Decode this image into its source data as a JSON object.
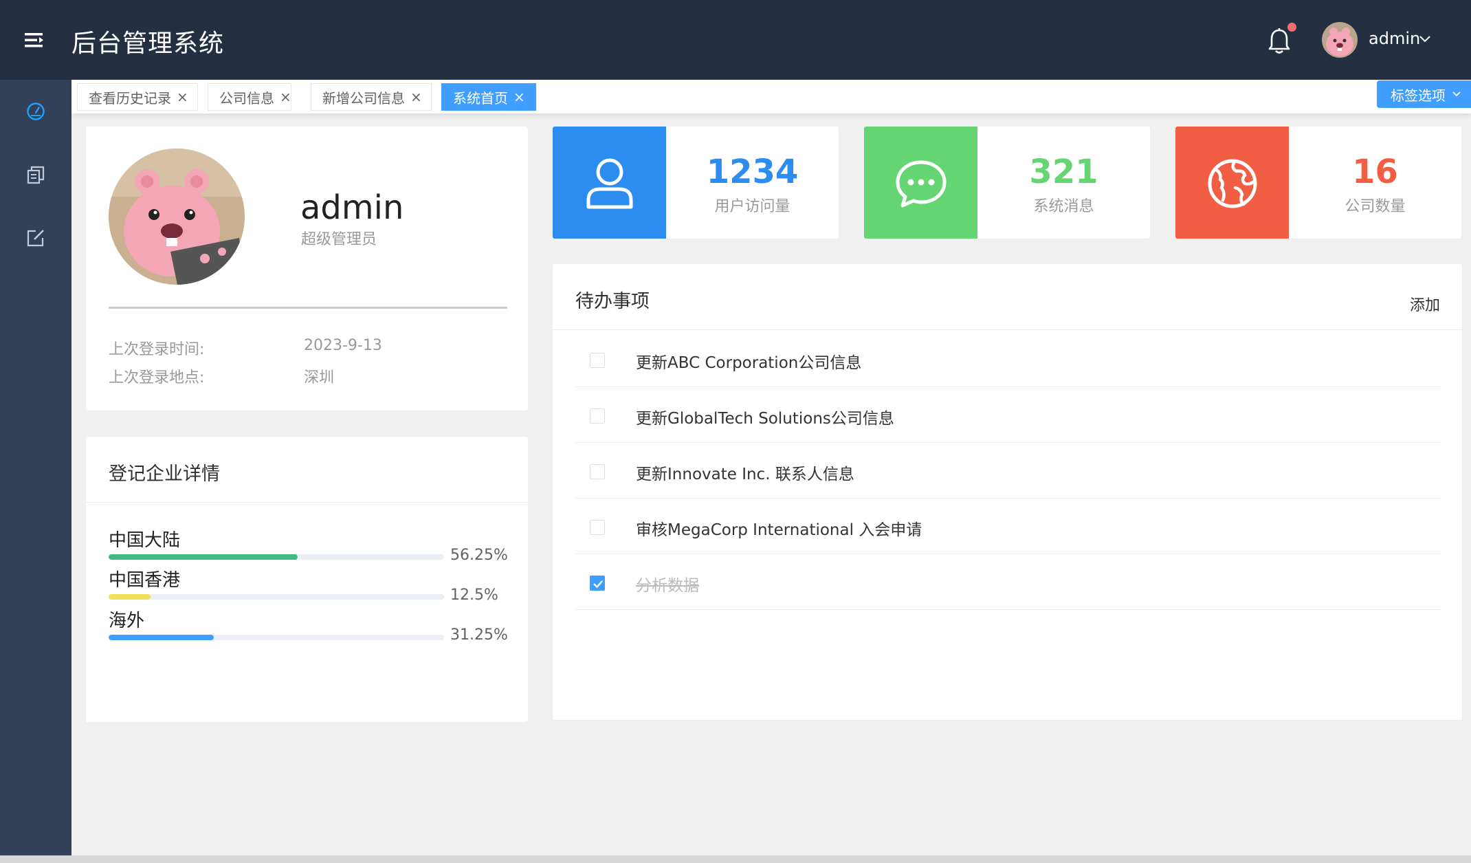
{
  "header": {
    "title": "后台管理系统",
    "username": "admin",
    "menu_icon": "menu-fold-icon",
    "bell_icon": "bell-icon",
    "has_unread": true
  },
  "sidebar": {
    "items": [
      {
        "icon": "dashboard-icon",
        "active": true
      },
      {
        "icon": "document-copy-icon",
        "active": false
      },
      {
        "icon": "edit-icon",
        "active": false
      }
    ]
  },
  "tags": {
    "items": [
      {
        "label": "查看历史记录",
        "active": false
      },
      {
        "label": "公司信息",
        "active": false
      },
      {
        "label": "新增公司信息",
        "active": false
      },
      {
        "label": "系统首页",
        "active": true
      }
    ],
    "options_label": "标签选项"
  },
  "profile": {
    "name": "admin",
    "role": "超级管理员",
    "last_login_time_label": "上次登录时间:",
    "last_login_time": "2023-9-13",
    "last_login_place_label": "上次登录地点:",
    "last_login_place": "深圳"
  },
  "regions": {
    "title": "登记企业详情",
    "items": [
      {
        "name": "中国大陆",
        "percent": 56.25,
        "label": "56.25%",
        "color": "#42b983"
      },
      {
        "name": "中国香港",
        "percent": 12.5,
        "label": "12.5%",
        "color": "#f1e05a"
      },
      {
        "name": "海外",
        "percent": 31.25,
        "label": "31.25%",
        "color": "#409eff"
      }
    ]
  },
  "stats": [
    {
      "value": "1234",
      "label": "用户访问量",
      "color": "#2d8cf0",
      "icon": "user-icon"
    },
    {
      "value": "321",
      "label": "系统消息",
      "color": "#64d572",
      "icon": "chat-dots-icon"
    },
    {
      "value": "16",
      "label": "公司数量",
      "color": "#f25e43",
      "icon": "globe-icon"
    }
  ],
  "todo": {
    "title": "待办事项",
    "add_label": "添加",
    "items": [
      {
        "text": "更新ABC Corporation公司信息",
        "done": false
      },
      {
        "text": "更新GlobalTech Solutions公司信息",
        "done": false
      },
      {
        "text": "更新Innovate Inc. 联系人信息",
        "done": false
      },
      {
        "text": "审核MegaCorp International 入会申请",
        "done": false
      },
      {
        "text": "分析数据",
        "done": true
      }
    ]
  }
}
